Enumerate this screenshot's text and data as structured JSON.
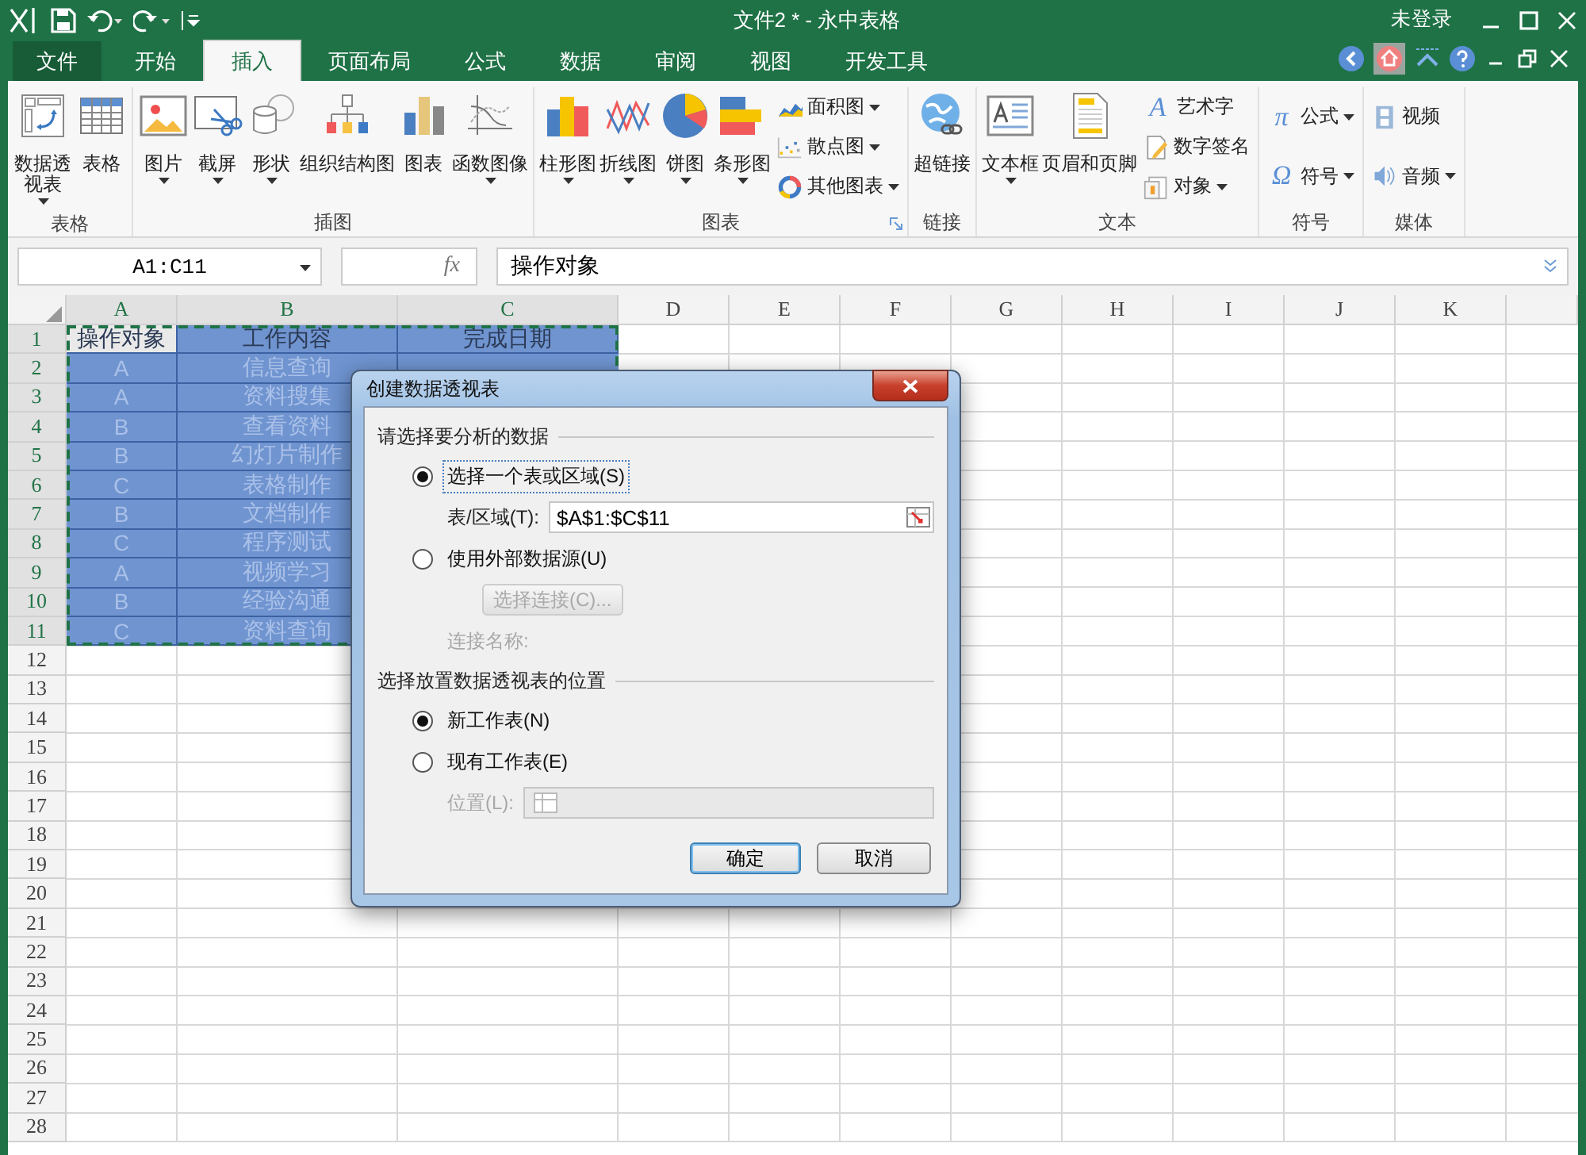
{
  "window": {
    "title": "文件2 * - 永中表格",
    "account": "未登录"
  },
  "tabs": [
    {
      "label": "文件",
      "kind": "file",
      "selected": false
    },
    {
      "label": "开始",
      "kind": "tab",
      "selected": false
    },
    {
      "label": "插入",
      "kind": "tab",
      "selected": true
    },
    {
      "label": "页面布局",
      "kind": "tab",
      "selected": false
    },
    {
      "label": "公式",
      "kind": "tab",
      "selected": false
    },
    {
      "label": "数据",
      "kind": "tab",
      "selected": false
    },
    {
      "label": "审阅",
      "kind": "tab",
      "selected": false
    },
    {
      "label": "视图",
      "kind": "tab",
      "selected": false
    },
    {
      "label": "开发工具",
      "kind": "tab",
      "selected": false
    }
  ],
  "ribbon": {
    "groups": [
      {
        "label": "表格",
        "launcher": false,
        "items": [
          {
            "label": "数据透视表",
            "kind": "large",
            "wrap": true,
            "dropdown": true
          },
          {
            "label": "表格",
            "kind": "large",
            "wrap": false,
            "dropdown": false
          }
        ]
      },
      {
        "label": "插图",
        "launcher": false,
        "items": [
          {
            "label": "图片",
            "kind": "large",
            "wrap": false,
            "dropdown": true
          },
          {
            "label": "截屏",
            "kind": "large",
            "wrap": false,
            "dropdown": true
          },
          {
            "label": "形状",
            "kind": "large",
            "wrap": false,
            "dropdown": true
          },
          {
            "label": "组织结构图",
            "kind": "large",
            "wrap": false,
            "dropdown": false
          },
          {
            "label": "图表",
            "kind": "large",
            "wrap": false,
            "dropdown": false
          },
          {
            "label": "函数图像",
            "kind": "large",
            "wrap": false,
            "dropdown": true
          }
        ]
      },
      {
        "label": "图表",
        "launcher": true,
        "items": [
          {
            "label": "柱形图",
            "kind": "large",
            "wrap": false,
            "dropdown": true
          },
          {
            "label": "折线图",
            "kind": "large",
            "wrap": false,
            "dropdown": true
          },
          {
            "label": "饼图",
            "kind": "large",
            "wrap": false,
            "dropdown": true
          },
          {
            "label": "条形图",
            "kind": "large",
            "wrap": false,
            "dropdown": true
          },
          {
            "label": "面积图",
            "kind": "small",
            "dropdown": true
          },
          {
            "label": "散点图",
            "kind": "small",
            "dropdown": true
          },
          {
            "label": "其他图表",
            "kind": "small",
            "dropdown": true
          }
        ]
      },
      {
        "label": "链接",
        "launcher": false,
        "items": [
          {
            "label": "超链接",
            "kind": "large",
            "wrap": false,
            "dropdown": false
          }
        ]
      },
      {
        "label": "文本",
        "launcher": false,
        "items": [
          {
            "label": "文本框",
            "kind": "large",
            "wrap": false,
            "dropdown": true
          },
          {
            "label": "页眉和页脚",
            "kind": "large",
            "wrap": false,
            "dropdown": false
          },
          {
            "label": "艺术字",
            "kind": "small",
            "glyph": "A",
            "dropdown": false
          },
          {
            "label": "数字签名",
            "kind": "small",
            "dropdown": false
          },
          {
            "label": "对象",
            "kind": "small",
            "dropdown": true
          }
        ]
      },
      {
        "label": "符号",
        "launcher": false,
        "items": [
          {
            "label": "公式",
            "kind": "small",
            "glyph": "π",
            "dropdown": true
          },
          {
            "label": "符号",
            "kind": "small",
            "glyph": "Ω",
            "dropdown": true
          }
        ]
      },
      {
        "label": "媒体",
        "launcher": false,
        "items": [
          {
            "label": "视频",
            "kind": "small",
            "dropdown": false
          },
          {
            "label": "音频",
            "kind": "small",
            "dropdown": true
          }
        ]
      }
    ]
  },
  "formula_bar": {
    "name_box": "A1:C11",
    "fx": "fx",
    "content": "操作对象"
  },
  "sheet": {
    "columns": [
      {
        "label": "A",
        "selected": true
      },
      {
        "label": "B",
        "selected": true
      },
      {
        "label": "C",
        "selected": true
      },
      {
        "label": "D",
        "selected": false
      },
      {
        "label": "E",
        "selected": false
      },
      {
        "label": "F",
        "selected": false
      },
      {
        "label": "G",
        "selected": false
      },
      {
        "label": "H",
        "selected": false
      },
      {
        "label": "I",
        "selected": false
      },
      {
        "label": "J",
        "selected": false
      },
      {
        "label": "K",
        "selected": false
      }
    ],
    "rows": [
      {
        "header": "1",
        "selected": true,
        "kind": "heading",
        "cells": [
          {
            "text": "操作对象",
            "active": true
          },
          {
            "text": "工作内容",
            "active": false
          },
          {
            "text": "完成日期",
            "active": false
          }
        ]
      },
      {
        "header": "2",
        "selected": true,
        "kind": "data",
        "cells": [
          {
            "text": "A",
            "active": false
          },
          {
            "text": "信息查询",
            "active": false
          }
        ]
      },
      {
        "header": "3",
        "selected": true,
        "kind": "data",
        "cells": [
          {
            "text": "A",
            "active": false
          },
          {
            "text": "资料搜集",
            "active": false
          }
        ]
      },
      {
        "header": "4",
        "selected": true,
        "kind": "data",
        "cells": [
          {
            "text": "B",
            "active": false
          },
          {
            "text": "查看资料",
            "active": false
          }
        ]
      },
      {
        "header": "5",
        "selected": true,
        "kind": "data",
        "cells": [
          {
            "text": "B",
            "active": false
          },
          {
            "text": "幻灯片制作",
            "active": false
          }
        ]
      },
      {
        "header": "6",
        "selected": true,
        "kind": "data",
        "cells": [
          {
            "text": "C",
            "active": false
          },
          {
            "text": "表格制作",
            "active": false
          }
        ]
      },
      {
        "header": "7",
        "selected": true,
        "kind": "data",
        "cells": [
          {
            "text": "B",
            "active": false
          },
          {
            "text": "文档制作",
            "active": false
          }
        ]
      },
      {
        "header": "8",
        "selected": true,
        "kind": "data",
        "cells": [
          {
            "text": "C",
            "active": false
          },
          {
            "text": "程序测试",
            "active": false
          }
        ]
      },
      {
        "header": "9",
        "selected": true,
        "kind": "data",
        "cells": [
          {
            "text": "A",
            "active": false
          },
          {
            "text": "视频学习",
            "active": false
          }
        ]
      },
      {
        "header": "10",
        "selected": true,
        "kind": "data",
        "cells": [
          {
            "text": "B",
            "active": false
          },
          {
            "text": "经验沟通",
            "active": false
          }
        ]
      },
      {
        "header": "11",
        "selected": true,
        "kind": "data",
        "cells": [
          {
            "text": "C",
            "active": false
          },
          {
            "text": "资料查询",
            "active": false
          }
        ]
      },
      {
        "header": "12",
        "selected": false,
        "kind": "data",
        "cells": []
      },
      {
        "header": "13",
        "selected": false,
        "kind": "data",
        "cells": []
      },
      {
        "header": "14",
        "selected": false,
        "kind": "data",
        "cells": []
      },
      {
        "header": "15",
        "selected": false,
        "kind": "data",
        "cells": []
      },
      {
        "header": "16",
        "selected": false,
        "kind": "data",
        "cells": []
      },
      {
        "header": "17",
        "selected": false,
        "kind": "data",
        "cells": []
      },
      {
        "header": "18",
        "selected": false,
        "kind": "data",
        "cells": []
      },
      {
        "header": "19",
        "selected": false,
        "kind": "data",
        "cells": []
      },
      {
        "header": "20",
        "selected": false,
        "kind": "data",
        "cells": []
      },
      {
        "header": "21",
        "selected": false,
        "kind": "data",
        "cells": []
      },
      {
        "header": "22",
        "selected": false,
        "kind": "data",
        "cells": []
      },
      {
        "header": "23",
        "selected": false,
        "kind": "data",
        "cells": []
      },
      {
        "header": "24",
        "selected": false,
        "kind": "data",
        "cells": []
      },
      {
        "header": "25",
        "selected": false,
        "kind": "data",
        "cells": []
      },
      {
        "header": "26",
        "selected": false,
        "kind": "data",
        "cells": []
      },
      {
        "header": "27",
        "selected": false,
        "kind": "data",
        "cells": []
      },
      {
        "header": "28",
        "selected": false,
        "kind": "data",
        "cells": []
      }
    ]
  },
  "dialog": {
    "title": "创建数据透视表",
    "sections": [
      {
        "label": "请选择要分析的数据",
        "items": [
          {
            "kind": "radio",
            "label": "选择一个表或区域(S)",
            "selected": true,
            "focused": true
          },
          {
            "kind": "field",
            "label": "表/区域(T):",
            "value": "$A$1:$C$11",
            "disabled": false
          },
          {
            "kind": "radio",
            "label": "使用外部数据源(U)",
            "selected": false,
            "focused": false
          },
          {
            "kind": "button",
            "label": "选择连接(C)...",
            "disabled": true
          },
          {
            "kind": "label",
            "label": "连接名称:",
            "disabled": true
          }
        ]
      },
      {
        "label": "选择放置数据透视表的位置",
        "items": [
          {
            "kind": "radio",
            "label": "新工作表(N)",
            "selected": true,
            "focused": false
          },
          {
            "kind": "radio",
            "label": "现有工作表(E)",
            "selected": false,
            "focused": false
          },
          {
            "kind": "field",
            "label": "位置(L):",
            "disabled": true
          }
        ]
      }
    ],
    "buttons": [
      {
        "label": "确定",
        "default": true
      },
      {
        "label": "取消",
        "default": false
      }
    ]
  }
}
